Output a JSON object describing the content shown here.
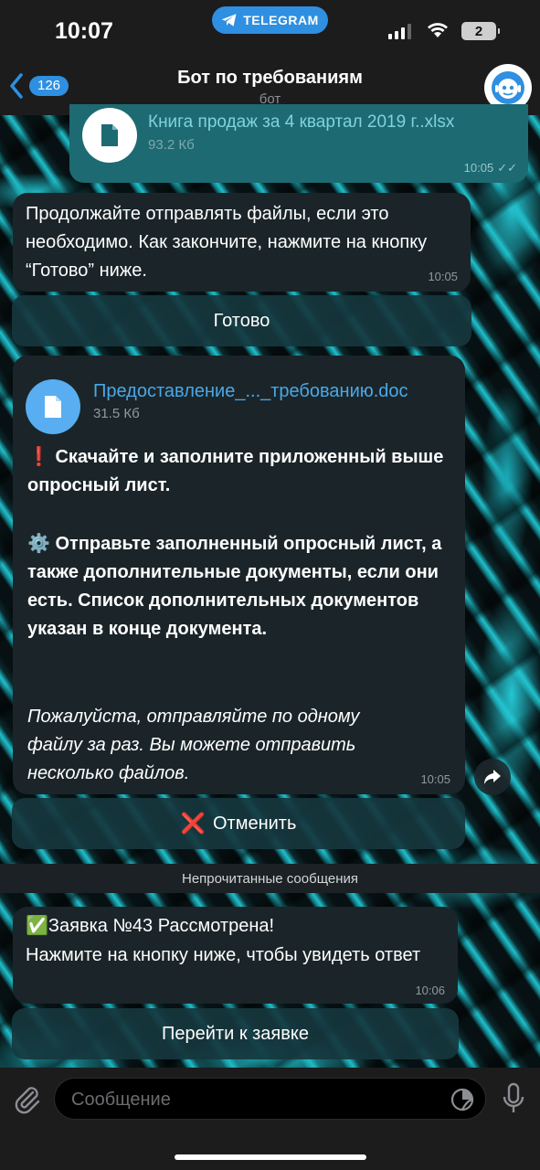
{
  "status_bar": {
    "time": "10:07",
    "app_pill": "TELEGRAM",
    "battery": "2"
  },
  "header": {
    "back_count": "126",
    "title": "Бот по требованиям",
    "subtitle": "бот"
  },
  "messages": {
    "file_out": {
      "name": "Книга продаж за 4 квартал 2019 г..xlsx",
      "size": "93.2 Кб",
      "time": "10:05"
    },
    "continue_msg": {
      "text": "Продолжайте отправлять файлы, если это необходимо. Как закончите, нажмите на кнопку “Готово” ниже.",
      "time": "10:05",
      "button": "Готово"
    },
    "questionnaire": {
      "file_name": "Предоставление_..._требованию.doc",
      "file_size": "31.5 Кб",
      "warn_emoji": "❗",
      "line1": "Скачайте и заполните приложенный выше опросный лист.",
      "gear_emoji": "⚙️",
      "line2": "Отправьте заполненный опросный лист, а также дополнительные документы, если они есть. Список дополнительных документов указан в конце документа.",
      "note": "Пожалуйста, отправляйте по одному файлу за раз. Вы можете отправить несколько файлов.",
      "time": "10:05",
      "cancel_emoji": "❌",
      "cancel_button": "Отменить"
    },
    "unread_label": "Непрочитанные сообщения",
    "request": {
      "check_emoji": "✅",
      "title": "Заявка №43 Рассмотрена!",
      "body": "Нажмите на кнопку ниже, чтобы увидеть ответ",
      "time": "10:06",
      "button": "Перейти к заявке"
    }
  },
  "input": {
    "placeholder": "Сообщение"
  },
  "colors": {
    "accent": "#2f8fe0",
    "bubble_in": "#1b2529",
    "bubble_out": "#1d6a72",
    "file_icon": "#58aef0"
  }
}
